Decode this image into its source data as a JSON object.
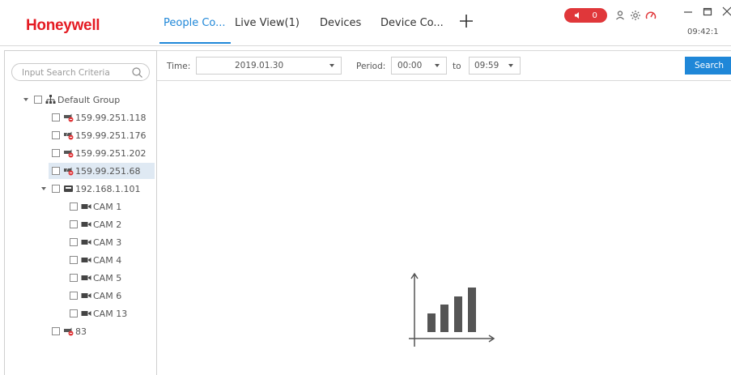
{
  "header": {
    "brand": "Honeywell",
    "tabs": [
      {
        "label": "People Co...",
        "active": true
      },
      {
        "label": "Live View(1)",
        "active": false
      },
      {
        "label": "Devices",
        "active": false
      },
      {
        "label": "Device Co...",
        "active": false
      }
    ],
    "add_tab_icon": "plus-icon",
    "alarm_count": "0",
    "clock": "09:42:1",
    "colors": {
      "accent": "#1f87d8",
      "brand": "#e41b23",
      "alarm": "#e0373a"
    }
  },
  "sidebar": {
    "search_placeholder": "Input Search Criteria",
    "tree": {
      "group_label": "Default Group",
      "devices": [
        {
          "label": "159.99.251.118",
          "status": "offline"
        },
        {
          "label": "159.99.251.176",
          "status": "unknown"
        },
        {
          "label": "159.99.251.202",
          "status": "offline"
        },
        {
          "label": "159.99.251.68",
          "status": "unknown",
          "selected": true
        },
        {
          "label": "192.168.1.101",
          "status": "nvr"
        }
      ],
      "cameras": [
        {
          "label": "CAM 1"
        },
        {
          "label": "CAM 2"
        },
        {
          "label": "CAM 3"
        },
        {
          "label": "CAM 4"
        },
        {
          "label": "CAM 5"
        },
        {
          "label": "CAM 6"
        },
        {
          "label": "CAM 13"
        }
      ],
      "last_device": {
        "label": "83",
        "status": "offline"
      }
    }
  },
  "filters": {
    "time_label": "Time:",
    "date_value": "2019.01.30",
    "period_label": "Period:",
    "period_from": "00:00",
    "to_label": "to",
    "period_to": "09:59",
    "search_button": "Search"
  },
  "main": {
    "empty_state_icon": "bar-chart-icon"
  }
}
